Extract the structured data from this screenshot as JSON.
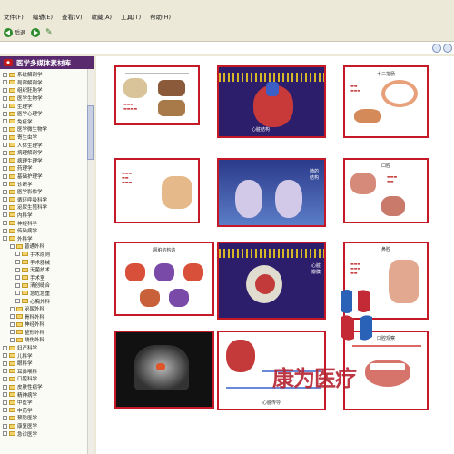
{
  "menu": [
    "文件(F)",
    "编辑(E)",
    "查看(V)",
    "收藏(A)",
    "工具(T)",
    "帮助(H)"
  ],
  "toolbar": {
    "back_label": "后退"
  },
  "sidebar": {
    "title": "医学多媒体素材库",
    "items": [
      "系统解剖学",
      "局部解剖学",
      "组织胚胎学",
      "医学生物学",
      "生理学",
      "医学心理学",
      "免疫学",
      "医学微生物学",
      "寄生虫学",
      "人体生理学",
      "病理解剖学",
      "病理生理学",
      "药理学",
      "基础护理学",
      "诊断学",
      "医学影像学",
      "循环呼吸科学",
      "泌尿生殖科学",
      "内科学",
      "神经科学",
      "传染病学",
      "外科学",
      "普通外科",
      "手术原则",
      "手术器械",
      "无菌技术",
      "手术室",
      "清创缝合",
      "急危急重",
      "心胸外科",
      "泌尿外科",
      "骨科外科",
      "神经外科",
      "整形外科",
      "烧伤外科",
      "妇产科学",
      "儿科学",
      "眼科学",
      "耳鼻喉科",
      "口腔科学",
      "皮肤性病学",
      "精神病学",
      "中医学",
      "中药学",
      "预防医学",
      "康复医学",
      "急诊医学"
    ]
  },
  "cards": [
    {
      "title": "",
      "caption": ""
    },
    {
      "title": "",
      "caption": "心脏结构"
    },
    {
      "title": "十二指肠",
      "caption": ""
    },
    {
      "title": "",
      "caption": ""
    },
    {
      "title": "",
      "caption": "肺的结构"
    },
    {
      "title": "口腔",
      "caption": ""
    },
    {
      "title": "肾脏的构造",
      "caption": ""
    },
    {
      "title": "",
      "caption": "心脏瓣膜"
    },
    {
      "title": "鼻腔",
      "caption": ""
    },
    {
      "title": "",
      "caption": ""
    },
    {
      "title": "",
      "caption": "心脏传导"
    },
    {
      "title": "口腔观察",
      "caption": ""
    }
  ],
  "watermark": "康为医疗",
  "colors": {
    "accent": "#c41a28",
    "purple": "#5a2a6e"
  }
}
